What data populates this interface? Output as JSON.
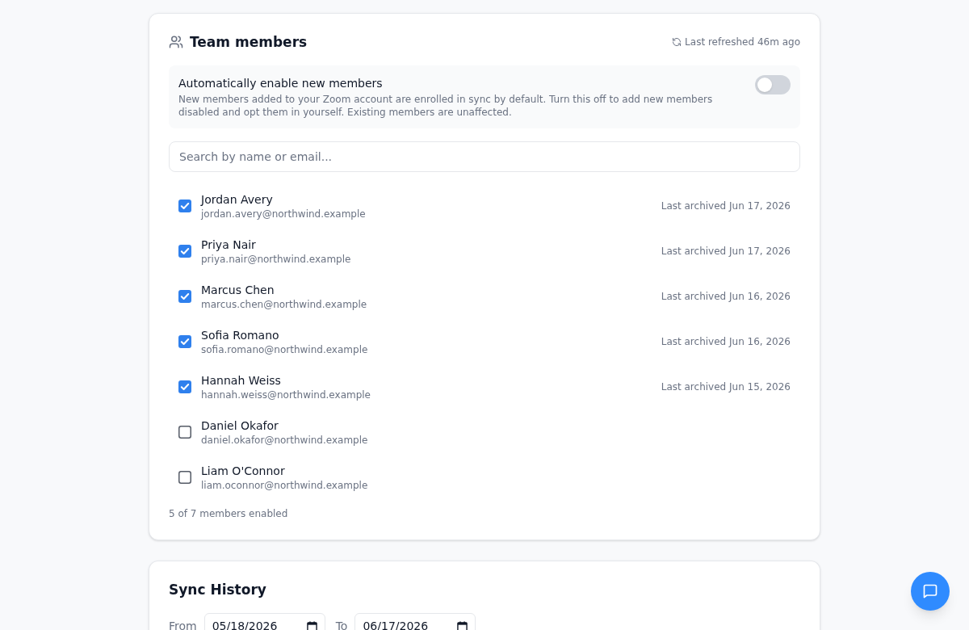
{
  "team_members": {
    "title": "Team members",
    "last_refreshed": "Last refreshed 46m ago",
    "auto_enable": {
      "label": "Automatically enable new members",
      "description": "New members added to your Zoom account are enrolled in sync by default. Turn this off to add new members disabled and opt them in yourself. Existing members are unaffected.",
      "on": false
    },
    "search": {
      "placeholder": "Search by name or email..."
    },
    "members": [
      {
        "name": "Jordan Avery",
        "email": "jordan.avery@northwind.example",
        "checked": true,
        "last_archived": "Last archived Jun 17, 2026"
      },
      {
        "name": "Priya Nair",
        "email": "priya.nair@northwind.example",
        "checked": true,
        "last_archived": "Last archived Jun 17, 2026"
      },
      {
        "name": "Marcus Chen",
        "email": "marcus.chen@northwind.example",
        "checked": true,
        "last_archived": "Last archived Jun 16, 2026"
      },
      {
        "name": "Sofia Romano",
        "email": "sofia.romano@northwind.example",
        "checked": true,
        "last_archived": "Last archived Jun 16, 2026"
      },
      {
        "name": "Hannah Weiss",
        "email": "hannah.weiss@northwind.example",
        "checked": true,
        "last_archived": "Last archived Jun 15, 2026"
      },
      {
        "name": "Daniel Okafor",
        "email": "daniel.okafor@northwind.example",
        "checked": false
      },
      {
        "name": "Liam O'Connor",
        "email": "liam.oconnor@northwind.example",
        "checked": false
      }
    ],
    "summary": "5 of 7 members enabled"
  },
  "sync_history": {
    "title": "Sync History",
    "date_range": [
      {
        "label": "From",
        "value": "05/18/2026"
      },
      {
        "label": "To",
        "value": "06/17/2026"
      }
    ]
  }
}
